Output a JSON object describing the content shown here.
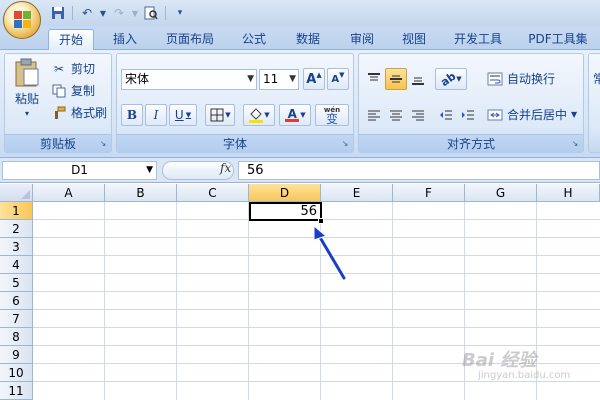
{
  "qat": {
    "items": [
      "save-icon",
      "undo-icon",
      "redo-icon",
      "print-preview-icon",
      "customize-icon"
    ]
  },
  "tabs": [
    {
      "label": "开始",
      "active": true
    },
    {
      "label": "插入"
    },
    {
      "label": "页面布局"
    },
    {
      "label": "公式"
    },
    {
      "label": "数据"
    },
    {
      "label": "审阅"
    },
    {
      "label": "视图"
    },
    {
      "label": "开发工具"
    },
    {
      "label": "PDF工具集"
    }
  ],
  "clipboard": {
    "paste": "粘贴",
    "cut": "剪切",
    "copy": "复制",
    "format_painter": "格式刷",
    "label": "剪贴板"
  },
  "font": {
    "name": "宋体",
    "size": "11",
    "grow": "A",
    "shrink": "A",
    "bold": "B",
    "italic": "I",
    "underline": "U",
    "color_letter": "A",
    "phonetic": "wén",
    "phonetic_char": "变",
    "label": "字体",
    "font_color": "#e53b2f",
    "fill_color": "#f5e400"
  },
  "alignment": {
    "wrap": "自动换行",
    "merge": "合并后居中",
    "label": "对齐方式"
  },
  "number_group_clip": "常",
  "formula_bar": {
    "name_box": "D1",
    "fx": "fx",
    "value": "56"
  },
  "sheet": {
    "columns": [
      "A",
      "B",
      "C",
      "D",
      "E",
      "F",
      "G",
      "H"
    ],
    "rows": [
      "1",
      "2",
      "3",
      "4",
      "5",
      "6",
      "7",
      "8",
      "9",
      "10",
      "11"
    ],
    "selected_column": "D",
    "selected_row": "1",
    "d1_value": "56"
  },
  "watermark": {
    "text": "Bai 经验",
    "sub": "jingyan.baidu.com"
  },
  "colors": {
    "arrow": "#1a3fc7",
    "selected_header": "#f9c75a"
  }
}
